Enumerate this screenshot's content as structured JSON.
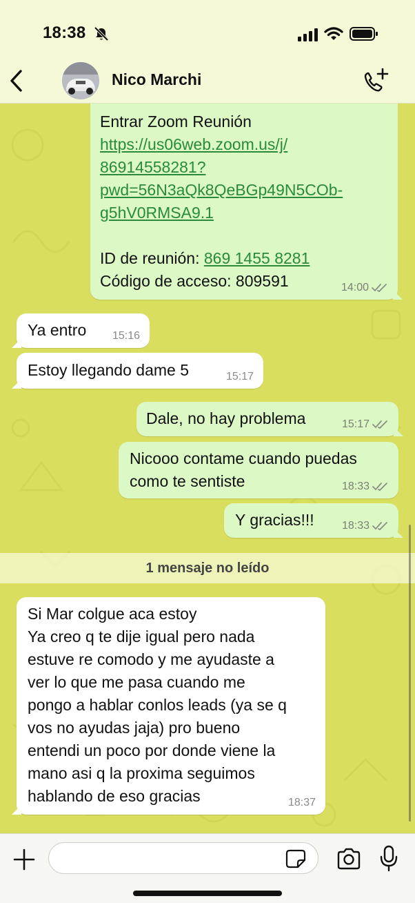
{
  "status_bar": {
    "time": "18:38"
  },
  "header": {
    "contact_name": "Nico Marchi"
  },
  "messages": [
    {
      "id": "m1",
      "direction": "out",
      "line1": "Entrar Zoom Reunión",
      "link_lines": [
        "https://us06web.zoom.us/j/",
        "86914558281?",
        "pwd=56N3aQk8QeBGp49N5COb-",
        "g5hV0RMSA9.1"
      ],
      "id_label": "ID de reunión: ",
      "id_value": "869 1455 8281",
      "code_line": "Código de acceso: 809591",
      "time": "14:00"
    },
    {
      "id": "m2",
      "direction": "in",
      "text": "Ya entro",
      "time": "15:16"
    },
    {
      "id": "m3",
      "direction": "in",
      "text": "Estoy llegando dame 5",
      "time": "15:17"
    },
    {
      "id": "m4",
      "direction": "out",
      "text": "Dale, no hay problema",
      "time": "15:17"
    },
    {
      "id": "m5",
      "direction": "out",
      "lines": [
        "Nicooo contame cuando puedas",
        "como te sentiste"
      ],
      "time": "18:33"
    },
    {
      "id": "m6",
      "direction": "out",
      "text": "Y gracias!!!",
      "time": "18:33"
    },
    {
      "id": "m7",
      "direction": "in",
      "lines": [
        "Si Mar colgue aca estoy",
        "Ya creo q te dije igual pero nada",
        "estuve re comodo y me ayudaste a",
        "ver lo que me pasa cuando me",
        "pongo a hablar conlos leads (ya se q",
        "vos no ayudas jaja) pro bueno",
        "entendi un poco por donde viene la",
        "mano asi q la proxima seguimos",
        "hablando de eso gracias"
      ],
      "time": "18:37"
    }
  ],
  "unread_banner": "1 mensaje no leído",
  "composer": {
    "placeholder": ""
  },
  "colors": {
    "wallpaper": "#d9de5e",
    "outgoing_bubble": "#dbf8c5",
    "incoming_bubble": "#ffffff",
    "link": "#2a8a3c",
    "header_bg": "#f6f9d8"
  },
  "icons": [
    "bell-off-icon",
    "signal-icon",
    "wifi-icon",
    "battery-icon",
    "back-icon",
    "add-call-icon",
    "plus-icon",
    "sticker-icon",
    "camera-icon",
    "mic-icon",
    "double-check-icon"
  ]
}
